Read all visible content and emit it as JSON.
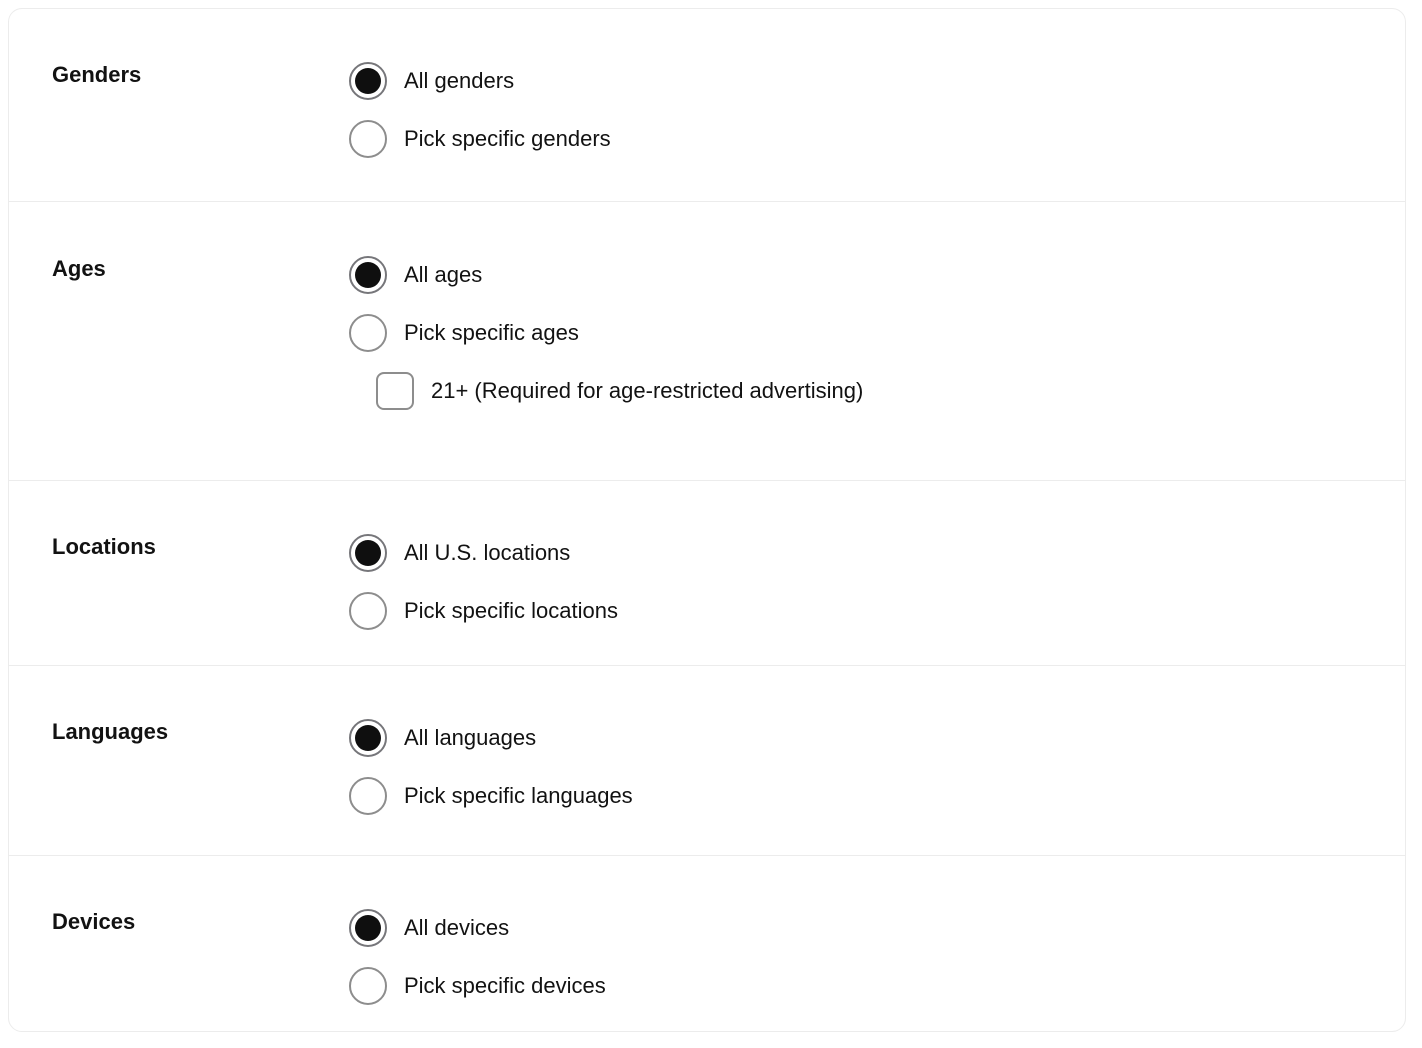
{
  "card": {
    "background_color": "#ffffff",
    "border_color": "#ececec",
    "divider_color": "#ececec",
    "text_color": "#121212",
    "control_border_color": "#8d8d8d",
    "radio_fill_color": "#0f0f0f"
  },
  "sections": [
    {
      "id": "genders",
      "label": "Genders",
      "options": [
        {
          "label": "All genders",
          "type": "radio",
          "selected": true
        },
        {
          "label": "Pick specific genders",
          "type": "radio",
          "selected": false
        }
      ]
    },
    {
      "id": "ages",
      "label": "Ages",
      "options": [
        {
          "label": "All ages",
          "type": "radio",
          "selected": true
        },
        {
          "label": "Pick specific ages",
          "type": "radio",
          "selected": false
        },
        {
          "label": "21+ (Required for age-restricted advertising)",
          "type": "checkbox",
          "checked": false,
          "indented": true
        }
      ]
    },
    {
      "id": "locations",
      "label": "Locations",
      "options": [
        {
          "label": "All U.S. locations",
          "type": "radio",
          "selected": true
        },
        {
          "label": "Pick specific locations",
          "type": "radio",
          "selected": false
        }
      ]
    },
    {
      "id": "languages",
      "label": "Languages",
      "options": [
        {
          "label": "All languages",
          "type": "radio",
          "selected": true
        },
        {
          "label": "Pick specific languages",
          "type": "radio",
          "selected": false
        }
      ]
    },
    {
      "id": "devices",
      "label": "Devices",
      "options": [
        {
          "label": "All devices",
          "type": "radio",
          "selected": true
        },
        {
          "label": "Pick specific devices",
          "type": "radio",
          "selected": false
        }
      ]
    }
  ]
}
